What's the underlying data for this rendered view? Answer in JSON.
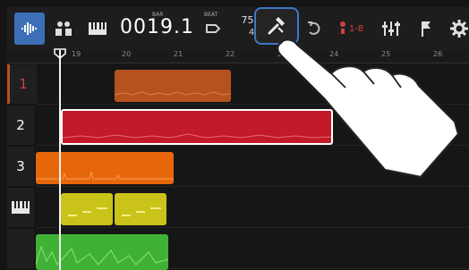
{
  "toolbar": {
    "counter_bar": "0019.1",
    "counter_bar_label": "BAR",
    "counter_beat_label": "BEAT",
    "tempo": "75.0",
    "time_signature": "4/4",
    "track_assign_label": "1-8"
  },
  "ruler": {
    "bars": [
      "19",
      "20",
      "21",
      "22",
      "23",
      "24",
      "25",
      "26"
    ]
  },
  "tracks": [
    {
      "label": "1",
      "color": "#b5521d"
    },
    {
      "label": "2",
      "color": "#c21a28"
    },
    {
      "label": "3",
      "color": "#e8660a"
    },
    {
      "label": "",
      "color": "#c9c31a"
    },
    {
      "label": "",
      "color": "#3fb235"
    }
  ],
  "colors": {
    "accent": "#3f77c8",
    "selected_button": "#3c6fb6"
  },
  "icons": {
    "mixer_view": "track-view-icon",
    "pad": "pads-icon",
    "keys": "keyboard-icon",
    "marker": "marker-icon",
    "tool": "tool-icon",
    "undo": "undo-icon",
    "track_assign": "track-assign-icon",
    "fader": "fader-icon",
    "settings": "gear-icon"
  }
}
